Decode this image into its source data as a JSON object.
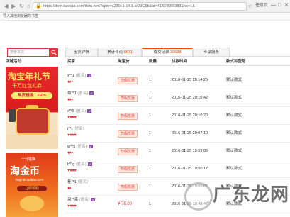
{
  "browser": {
    "url": "https://item.taobao.com/item.htm?spm=a230r.1.14.1.sr29G5b&id=41304556383&ns=1&",
    "tab_title": "任意页",
    "bookmark": "导入其他浏览器的书签"
  },
  "search": {
    "placeholder": "搜索本店"
  },
  "tabs": [
    {
      "label": "宝贝详情",
      "count": ""
    },
    {
      "label": "累计评论",
      "count": "6671"
    },
    {
      "label": "成交记录",
      "count": "30638"
    },
    {
      "label": "专享服务",
      "count": ""
    }
  ],
  "sidebar": {
    "title": "店铺活动",
    "ad1": {
      "line1": "淘宝年礼节",
      "line2": "千万红包礼券",
      "button": "年货超级... GO>"
    },
    "ad2": {
      "line0": "一分钱换",
      "line1": "淘金币",
      "line2": "Taojinbi taobao.com",
      "button": "立即领取"
    }
  },
  "table": {
    "headers": [
      "买家",
      "淘宝价",
      "数量",
      "付款时间",
      "款式和型号"
    ],
    "rows": [
      {
        "buyer": "x**1",
        "anon": "(匿名)",
        "hearts": "♦♦♦",
        "price": "节假优惠",
        "qty": "1",
        "time": "2016-01-25 20:14:25",
        "style": "默认款式"
      },
      {
        "buyer": "菊**1",
        "anon": "(匿名)",
        "hearts": "♦♦♦",
        "price": "节假优惠",
        "qty": "1",
        "time": "2016-01-25 20:10:42",
        "style": "默认款式"
      },
      {
        "buyer": "x**8",
        "anon": "(匿名)",
        "hearts": "♥♥♥♥",
        "price": "节假优惠",
        "qty": "1",
        "time": "2016-01-25 20:10:20",
        "style": "默认款式"
      },
      {
        "buyer": "j**r",
        "anon": "(匿名)",
        "hearts": "♥♥♥♥",
        "price": "节假优惠",
        "qty": "1",
        "time": "2016-01-25 20:07:10",
        "style": "默认款式"
      },
      {
        "buyer": "w**5",
        "anon": "(匿名)",
        "hearts": "♦♦♦",
        "price": "节假优惠",
        "qty": "1",
        "time": "2016-01-25 19:59:05",
        "style": "默认款式"
      },
      {
        "buyer": "b**g",
        "anon": "(匿名)",
        "hearts": "♥♥♥♥",
        "price": "节假优惠",
        "qty": "1",
        "time": "2016-01-25 19:50:17",
        "style": "默认款式"
      },
      {
        "buyer": "枉**1",
        "anon": "(匿名)",
        "hearts": "♦♦",
        "price": "节假优惠",
        "qty": "1",
        "time": "2016-01-25 19:50:05",
        "style": "默认款式"
      },
      {
        "buyer": "采**素",
        "anon": "(匿名)",
        "hearts": "♥♥♥♥",
        "price": "¥ 75.00",
        "qty": "1",
        "time": "2016-01-25 19:49:47",
        "style": "默认款式"
      }
    ]
  },
  "watermark": {
    "text": "广东龙网"
  },
  "colors": {
    "accent": "#e4393c",
    "tab_active": "#ff4400",
    "vip": "#8a4baf"
  }
}
